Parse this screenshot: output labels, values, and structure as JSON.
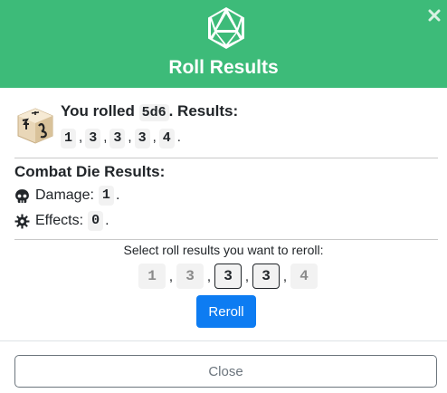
{
  "header": {
    "title": "Roll Results",
    "icon": "d20-icon",
    "close_icon": "close-icon",
    "color": "#3dbb79"
  },
  "roll": {
    "prefix": "You rolled",
    "formula": "5d6",
    "suffix": ". Results:",
    "results": [
      "1",
      "3",
      "3",
      "3",
      "4"
    ],
    "end": "."
  },
  "combat": {
    "title": "Combat Die Results:",
    "damage": {
      "label": "Damage:",
      "value": "1",
      "icon": "skull-icon"
    },
    "effects": {
      "label": "Effects:",
      "value": "0",
      "icon": "gear-icon"
    }
  },
  "reroll": {
    "prompt": "Select roll results you want to reroll:",
    "dice": [
      {
        "value": "1",
        "selected": false
      },
      {
        "value": "3",
        "selected": false
      },
      {
        "value": "3",
        "selected": true
      },
      {
        "value": "3",
        "selected": true
      },
      {
        "value": "4",
        "selected": false
      }
    ],
    "button_label": "Reroll",
    "button_color": "#0d7cf2"
  },
  "footer": {
    "close_label": "Close"
  }
}
